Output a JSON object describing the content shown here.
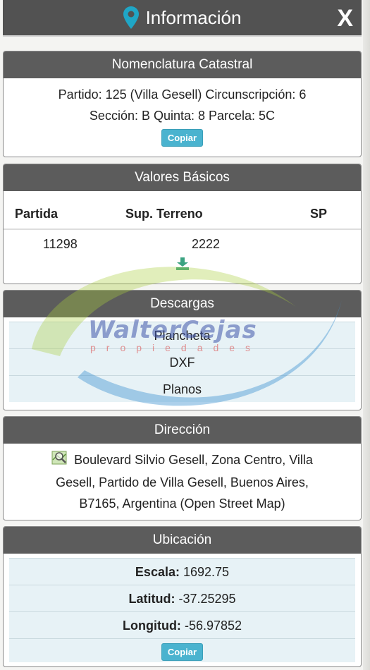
{
  "header": {
    "title": "Información",
    "close_label": "X",
    "pin_color": "#1fa6c6"
  },
  "nomenclatura": {
    "heading": "Nomenclatura Catastral",
    "line1": "Partido: 125 (Villa Gesell) Circunscripción: 6",
    "line2": "Sección: B Quinta: 8 Parcela: 5C",
    "copy_label": "Copiar"
  },
  "valores": {
    "heading": "Valores Básicos",
    "columns": [
      "Partida",
      "Sup. Terreno",
      "SP"
    ],
    "rows": [
      [
        "11298",
        "2222",
        ""
      ]
    ]
  },
  "descargas": {
    "heading": "Descargas",
    "items": [
      "Plancheta",
      "DXF",
      "Planos"
    ]
  },
  "direccion": {
    "heading": "Dirección",
    "line1": "Boulevard Silvio Gesell, Zona Centro, Villa",
    "line2": "Gesell, Partido de Villa Gesell, Buenos Aires,",
    "line3": "B7165, Argentina (Open Street Map)"
  },
  "ubicacion": {
    "heading": "Ubicación",
    "rows": [
      {
        "label": "Escala:",
        "value": "1692.75"
      },
      {
        "label": "Latitud:",
        "value": "-37.25295"
      },
      {
        "label": "Longitud:",
        "value": "-56.97852"
      }
    ],
    "copy_label": "Copiar"
  },
  "watermark": {
    "brand": "WalterCejas",
    "sub": "propiedades"
  },
  "colors": {
    "header_bg": "#525252",
    "accent": "#4ab3cf",
    "row_bg": "#e7f2f6"
  }
}
